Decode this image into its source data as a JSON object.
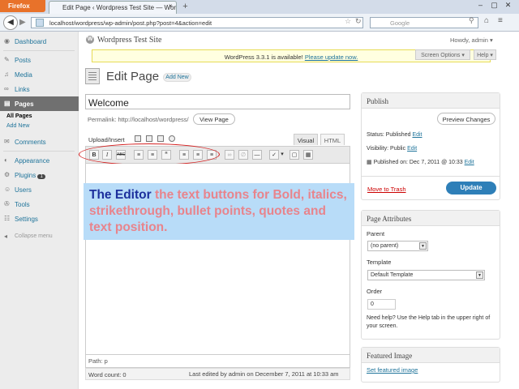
{
  "browser": {
    "app_button": "Firefox",
    "tab_title": "Edit Page ‹ Wordpress Test Site — Word...",
    "url": "localhost/wordpress/wp-admin/post.php?post=4&action=edit",
    "search_placeholder": "Google",
    "colors": {
      "app_button": "#e8722a",
      "tabbar": "#d3dce9"
    }
  },
  "sidebar": {
    "items": [
      {
        "label": "Dashboard",
        "icon": "dashboard-icon"
      },
      {
        "label": "Posts",
        "icon": "pin-icon"
      },
      {
        "label": "Media",
        "icon": "media-icon"
      },
      {
        "label": "Links",
        "icon": "link-icon"
      },
      {
        "label": "Pages",
        "icon": "page-icon"
      },
      {
        "label": "Comments",
        "icon": "comment-icon"
      },
      {
        "label": "Appearance",
        "icon": "appearance-icon"
      },
      {
        "label": "Plugins",
        "icon": "plugin-icon",
        "badge": "1"
      },
      {
        "label": "Users",
        "icon": "users-icon"
      },
      {
        "label": "Tools",
        "icon": "tools-icon"
      },
      {
        "label": "Settings",
        "icon": "settings-icon"
      }
    ],
    "pages_sub": [
      "All Pages",
      "Add New"
    ],
    "collapse": "Collapse menu"
  },
  "header": {
    "site_title": "Wordpress Test Site",
    "howdy": "Howdy, admin ▾",
    "notice_prefix": "WordPress 3.3.1 is available!",
    "notice_link": "Please update now.",
    "screen_options": "Screen Options ▾",
    "help": "Help ▾"
  },
  "main": {
    "page_title": "Edit Page",
    "add_new": "Add New",
    "post_title": "Welcome",
    "permalink": "Permalink: http://localhost/wordpress/",
    "view_page": "View Page",
    "upload_insert": "Upload/Insert",
    "tab_visual": "Visual",
    "tab_html": "HTML",
    "toolbar": [
      {
        "label": "B",
        "icon": "bold-icon"
      },
      {
        "label": "I",
        "icon": "italic-icon"
      },
      {
        "label": "ABC",
        "icon": "strikethrough-icon"
      },
      {
        "label": "≡",
        "icon": "bullet-list-icon"
      },
      {
        "label": "≡",
        "icon": "numbered-list-icon"
      },
      {
        "label": "“",
        "icon": "blockquote-icon"
      },
      {
        "label": "≡",
        "icon": "align-left-icon"
      },
      {
        "label": "≡",
        "icon": "align-center-icon"
      },
      {
        "label": "≡",
        "icon": "align-right-icon"
      },
      {
        "label": "∞",
        "icon": "insert-link-icon"
      },
      {
        "label": "∅",
        "icon": "unlink-icon"
      },
      {
        "label": "—",
        "icon": "more-tag-icon"
      },
      {
        "label": "✓",
        "icon": "spellcheck-icon"
      },
      {
        "label": "▾",
        "icon": "spellcheck-dropdown-icon"
      },
      {
        "label": "▢",
        "icon": "fullscreen-icon"
      },
      {
        "label": "▦",
        "icon": "kitchen-sink-icon"
      }
    ],
    "callout_title": "The Editor",
    "callout_body": " the text buttons for Bold, italics, strikethrough, bullet points, quotes and text position.",
    "path_label": "Path: p",
    "word_count": "Word count: 0",
    "last_edited": "Last edited by admin on December 7, 2011 at 10:33 am"
  },
  "publish": {
    "title": "Publish",
    "preview": "Preview Changes",
    "status": "Status: Published",
    "status_edit": "Edit",
    "visibility": "Visibility: Public",
    "visibility_edit": "Edit",
    "published_on": "Published on: Dec 7, 2011 @ 10:33",
    "published_edit": "Edit",
    "trash": "Move to Trash",
    "update": "Update"
  },
  "attributes": {
    "title": "Page Attributes",
    "parent_label": "Parent",
    "parent_value": "(no parent)",
    "template_label": "Template",
    "template_value": "Default Template",
    "order_label": "Order",
    "order_value": "0",
    "help_text": "Need help? Use the Help tab in the upper right of your screen."
  },
  "featured": {
    "title": "Featured Image",
    "link": "Set featured image"
  }
}
